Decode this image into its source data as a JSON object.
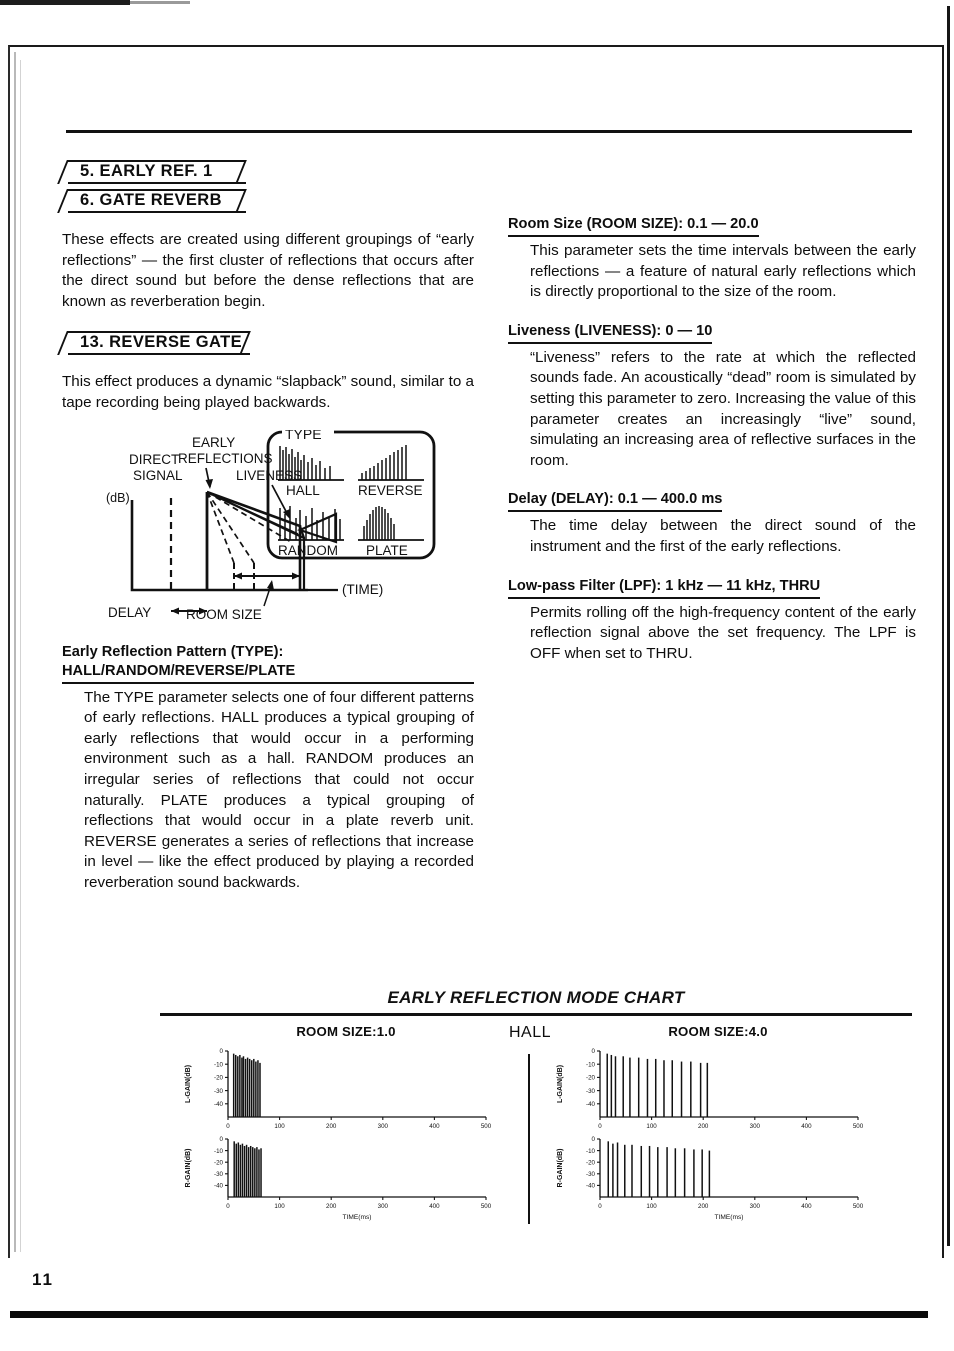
{
  "page": {
    "number": "11"
  },
  "left_column": {
    "banners": [
      {
        "label": "5. EARLY REF. 1"
      },
      {
        "label": "6. GATE REVERB"
      }
    ],
    "intro_paragraph": "These effects are created using different groupings of “early reflections” — the first cluster of reflections that occurs after the direct sound but before the dense reflections that are known as reverberation begin.",
    "banner_reverse": {
      "label": "13. REVERSE GATE"
    },
    "reverse_paragraph": "This effect produces a dynamic “slapback” sound, similar to a tape recording being played backwards.",
    "type_param": {
      "heading_line1": "Early Reflection Pattern (TYPE):",
      "heading_line2": "HALL/RANDOM/REVERSE/PLATE",
      "body": "The TYPE parameter selects one of four different patterns of early reflections. HALL produces a typical grouping of early reflections that would occur in a performing environment such as a hall. RANDOM produces an irregular series of reflections that could not occur naturally. PLATE produces a typical grouping of reflections that would occur in a plate reverb unit. REVERSE generates a series of reflections that increase in level — like the effect produced by playing a recorded reverberation sound backwards."
    }
  },
  "diagram": {
    "y_axis_label": "(dB)",
    "x_axis_label": "(TIME)",
    "direct_signal_label_line1": "DIRECT",
    "direct_signal_label_line2": "SIGNAL",
    "early_reflections_label_line1": "EARLY",
    "early_reflections_label_line2": "REFLECTIONS",
    "liveness_label": "LIVENESS",
    "delay_label": "DELAY",
    "room_size_label": "ROOM SIZE",
    "type_box_label": "TYPE",
    "type_patterns": [
      {
        "name": "HALL"
      },
      {
        "name": "REVERSE"
      },
      {
        "name": "RANDOM"
      },
      {
        "name": "PLATE"
      }
    ]
  },
  "right_column": {
    "params": [
      {
        "heading": "Room Size (ROOM SIZE): 0.1 — 20.0",
        "body": "This parameter sets the time intervals between the early reflections — a feature of natural early reflections which is directly proportional to the size of the room."
      },
      {
        "heading": "Liveness (LIVENESS): 0 — 10",
        "body": "“Liveness” refers to the rate at which the reflected sounds fade. An acoustically “dead” room is simulated by setting this parameter to zero. Increasing the value of this parameter creates an increasingly “live” sound, simulating an increasing area of reflective surfaces in the room."
      },
      {
        "heading": "Delay (DELAY): 0.1 — 400.0 ms",
        "body": "The time delay between the direct sound of the instrument and the first of the early reflections."
      },
      {
        "heading": "Low-pass Filter (LPF): 1 kHz — 11 kHz, THRU",
        "body": "Permits rolling off the high-frequency content of the early reflection signal above the set frequency. The LPF is OFF when set to THRU."
      }
    ]
  },
  "chart_section": {
    "title": "EARLY REFLECTION MODE CHART",
    "mode_label": "HALL",
    "left_group_label": "ROOM SIZE:1.0",
    "right_group_label": "ROOM SIZE:4.0"
  },
  "chart_data": [
    {
      "type": "bar",
      "title": "ROOM SIZE:1.0 — L-GAIN",
      "ylabel": "L-GAIN(dB)",
      "xlabel": "",
      "xlim": [
        0,
        500
      ],
      "ylim": [
        -50,
        0
      ],
      "xticks": [
        0,
        100,
        200,
        300,
        400,
        500
      ],
      "xticklabels": [
        "0",
        "100",
        "200",
        "300",
        "400",
        "500"
      ],
      "yticks": [
        0,
        -10,
        -20,
        -30,
        -40
      ],
      "yticklabels": [
        "0",
        "-10",
        "-20",
        "-30",
        "-40"
      ],
      "grid": false,
      "x": [
        11,
        15,
        19,
        23,
        27,
        30,
        34,
        38,
        42,
        46,
        50,
        54,
        58,
        62
      ],
      "values": [
        -2,
        -3,
        -4,
        -3,
        -5,
        -4,
        -6,
        -5,
        -6,
        -7,
        -6,
        -8,
        -7,
        -9
      ]
    },
    {
      "type": "bar",
      "title": "ROOM SIZE:1.0 — R-GAIN",
      "ylabel": "R-GAIN(dB)",
      "xlabel": "TIME(ms)",
      "xlim": [
        0,
        500
      ],
      "ylim": [
        -50,
        0
      ],
      "xticks": [
        0,
        100,
        200,
        300,
        400,
        500
      ],
      "xticklabels": [
        "0",
        "100",
        "200",
        "300",
        "400",
        "500"
      ],
      "yticks": [
        0,
        -10,
        -20,
        -30,
        -40
      ],
      "yticklabels": [
        "0",
        "-10",
        "-20",
        "-30",
        "-40"
      ],
      "grid": false,
      "x": [
        12,
        16,
        20,
        24,
        28,
        32,
        36,
        40,
        44,
        48,
        52,
        56,
        60,
        64
      ],
      "values": [
        -2,
        -4,
        -3,
        -5,
        -4,
        -6,
        -5,
        -7,
        -6,
        -7,
        -8,
        -7,
        -9,
        -8
      ]
    },
    {
      "type": "bar",
      "title": "ROOM SIZE:4.0 — L-GAIN",
      "ylabel": "L-GAIN(dB)",
      "xlabel": "",
      "xlim": [
        0,
        500
      ],
      "ylim": [
        -50,
        0
      ],
      "xticks": [
        0,
        100,
        200,
        300,
        400,
        500
      ],
      "xticklabels": [
        "0",
        "100",
        "200",
        "300",
        "400",
        "500"
      ],
      "yticks": [
        0,
        -10,
        -20,
        -30,
        -40
      ],
      "yticklabels": [
        "0",
        "-10",
        "-20",
        "-30",
        "-40"
      ],
      "grid": false,
      "x": [
        14,
        22,
        30,
        45,
        58,
        75,
        92,
        108,
        124,
        140,
        158,
        176,
        195,
        208
      ],
      "values": [
        -2,
        -3,
        -4,
        -4,
        -5,
        -5,
        -6,
        -6,
        -7,
        -7,
        -8,
        -8,
        -9,
        -9
      ]
    },
    {
      "type": "bar",
      "title": "ROOM SIZE:4.0 — R-GAIN",
      "ylabel": "R-GAIN(dB)",
      "xlabel": "TIME(ms)",
      "xlim": [
        0,
        500
      ],
      "ylim": [
        -50,
        0
      ],
      "xticks": [
        0,
        100,
        200,
        300,
        400,
        500
      ],
      "xticklabels": [
        "0",
        "100",
        "200",
        "300",
        "400",
        "500"
      ],
      "yticks": [
        0,
        -10,
        -20,
        -30,
        -40
      ],
      "yticklabels": [
        "0",
        "-10",
        "-20",
        "-30",
        "-40"
      ],
      "grid": false,
      "x": [
        16,
        25,
        34,
        48,
        62,
        80,
        96,
        112,
        130,
        146,
        164,
        182,
        198,
        212
      ],
      "values": [
        -2,
        -4,
        -3,
        -5,
        -5,
        -6,
        -6,
        -7,
        -7,
        -8,
        -8,
        -9,
        -9,
        -10
      ]
    }
  ]
}
